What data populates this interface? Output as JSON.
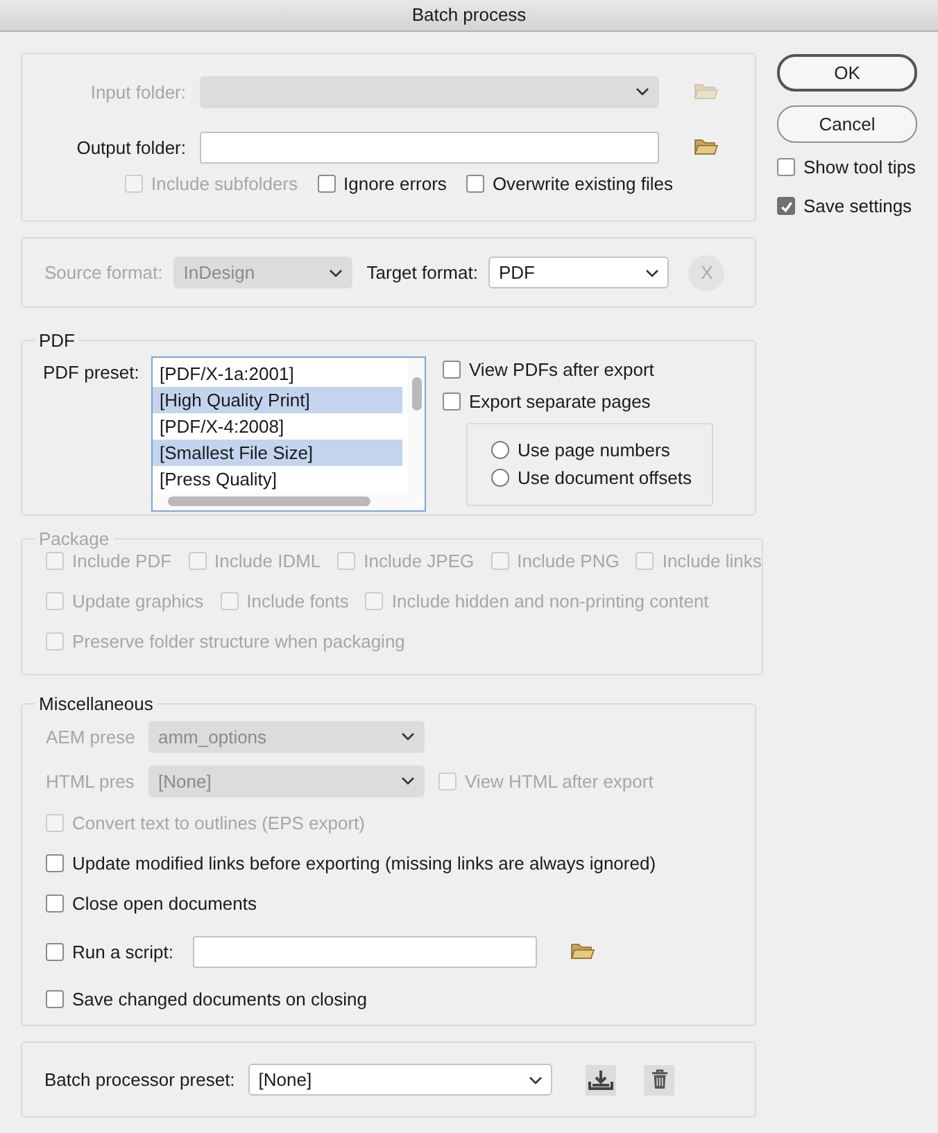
{
  "window": {
    "title": "Batch process"
  },
  "folders": [
    {
      "label": "Input folder:",
      "disabled": true,
      "kind": "dropdown"
    },
    {
      "label": "Output folder:",
      "disabled": false,
      "kind": "text"
    }
  ],
  "folder_options": [
    {
      "label": "Include subfolders",
      "checked": false,
      "disabled": true
    },
    {
      "label": "Ignore errors",
      "checked": false,
      "disabled": false
    },
    {
      "label": "Overwrite existing files",
      "checked": false,
      "disabled": false
    }
  ],
  "format": {
    "source_label": "Source format:",
    "source_value": "InDesign",
    "source_disabled": true,
    "target_label": "Target format:",
    "target_value": "PDF",
    "clear": "X"
  },
  "pdf": {
    "title": "PDF",
    "preset_label": "PDF preset:",
    "presets": [
      {
        "label": "[PDF/X-1a:2001]",
        "selected": false
      },
      {
        "label": "[High Quality Print]",
        "selected": true
      },
      {
        "label": "[PDF/X-4:2008]",
        "selected": false
      },
      {
        "label": "[Smallest File Size]",
        "selected": true
      },
      {
        "label": "[Press Quality]",
        "selected": false
      }
    ],
    "options": [
      {
        "label": "View PDFs after export",
        "checked": false
      },
      {
        "label": "Export separate pages",
        "checked": false
      }
    ],
    "radios": [
      {
        "label": "Use page numbers",
        "selected": false
      },
      {
        "label": "Use document offsets",
        "selected": false
      }
    ]
  },
  "package": {
    "title": "Package",
    "disabled": true,
    "rows": [
      [
        {
          "label": "Include PDF",
          "checked": false
        },
        {
          "label": "Include IDML",
          "checked": false
        },
        {
          "label": "Include JPEG",
          "checked": false
        },
        {
          "label": "Include PNG",
          "checked": false
        },
        {
          "label": "Include links",
          "checked": false
        }
      ],
      [
        {
          "label": "Update graphics",
          "checked": false
        },
        {
          "label": "Include fonts",
          "checked": false
        },
        {
          "label": "Include hidden and non-printing content",
          "checked": false
        }
      ],
      [
        {
          "label": "Preserve folder structure when packaging",
          "checked": false
        }
      ]
    ]
  },
  "misc": {
    "title": "Miscellaneous",
    "presets": [
      {
        "label": "AEM prese",
        "value": "amm_options",
        "disabled": true
      },
      {
        "label": "HTML pres",
        "value": "[None]",
        "disabled": true,
        "option": {
          "label": "View HTML after export",
          "checked": false,
          "disabled": true
        }
      }
    ],
    "options": [
      {
        "kind": "checkbox",
        "label": "Convert text to outlines (EPS export)",
        "checked": false,
        "disabled": true
      },
      {
        "kind": "checkbox",
        "label": "Update modified links before exporting (missing links are always ignored)",
        "checked": false,
        "disabled": false
      },
      {
        "kind": "checkbox",
        "label": "Close open documents",
        "checked": false,
        "disabled": false
      },
      {
        "kind": "script",
        "label": "Run a script:",
        "checked": false,
        "disabled": false
      },
      {
        "kind": "checkbox",
        "label": "Save changed documents on closing",
        "checked": false,
        "disabled": false
      }
    ]
  },
  "footer": {
    "label": "Batch processor preset:",
    "value": "[None]"
  },
  "buttons": [
    {
      "label": "OK",
      "default": true
    },
    {
      "label": "Cancel",
      "default": false
    }
  ],
  "side_options": [
    {
      "label": "Show tool tips",
      "checked": false
    },
    {
      "label": "Save settings",
      "checked": true
    }
  ]
}
